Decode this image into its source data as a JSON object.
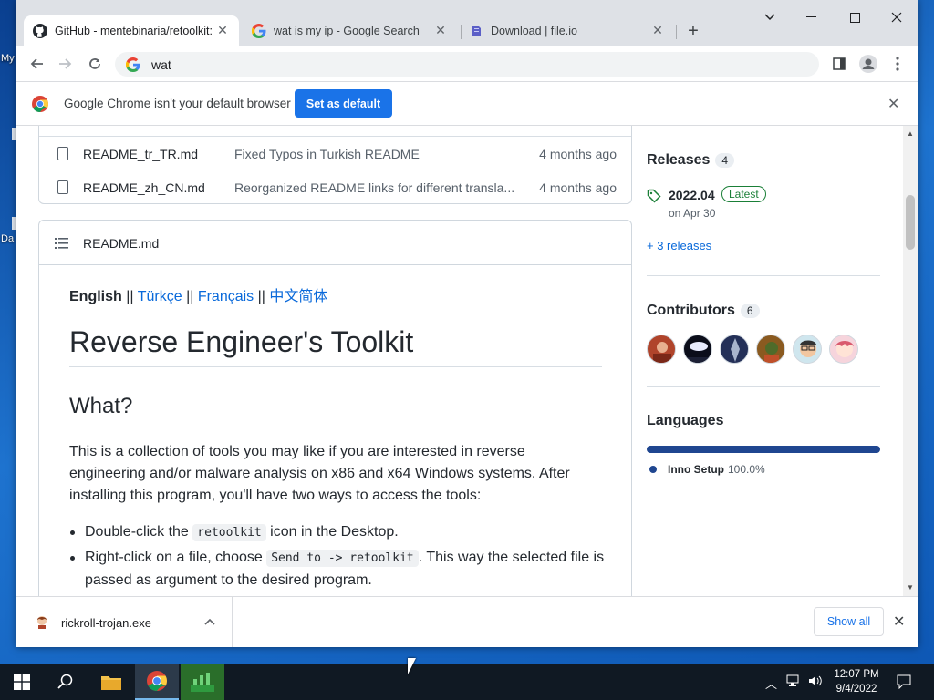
{
  "desktop": {
    "icon1_label": "My",
    "icon2_label": "Da"
  },
  "tabs": [
    {
      "title": "GitHub - mentebinaria/retoolkit: R",
      "icon": "github-icon"
    },
    {
      "title": "wat is my ip - Google Search",
      "icon": "google-icon"
    },
    {
      "title": "Download | file.io",
      "icon": "fileio-icon"
    }
  ],
  "omnibox": {
    "value": "wat"
  },
  "infobar": {
    "text": "Google Chrome isn't your default browser",
    "button": "Set as default"
  },
  "files": [
    {
      "name": "README_tr_TR.md",
      "message": "Fixed Typos in Turkish README",
      "age": "4 months ago"
    },
    {
      "name": "README_zh_CN.md",
      "message": "Reorganized README links for different transla...",
      "age": "4 months ago"
    }
  ],
  "readme": {
    "title": "README.md",
    "lang_english": "English",
    "sep": "||",
    "lang_turkce": "Türkçe",
    "lang_francais": "Français",
    "lang_chinese": "中文简体",
    "h1": "Reverse Engineer's Toolkit",
    "h2": "What?",
    "para": "This is a collection of tools you may like if you are interested in reverse engineering and/or malware analysis on x86 and x64 Windows systems. After installing this program, you'll have two ways to access the tools:",
    "bullet1_pre": "Double-click the ",
    "bullet1_code": "retoolkit",
    "bullet1_post": " icon in the Desktop.",
    "bullet2_pre": "Right-click on a file, choose ",
    "bullet2_code": "Send to -> retoolkit",
    "bullet2_post": ". This way the selected file is passed as argument to the desired program."
  },
  "sidebar": {
    "releases": {
      "heading": "Releases",
      "count": "4",
      "version": "2022.04",
      "badge": "Latest",
      "date": "on Apr 30",
      "more": "+ 3 releases"
    },
    "contributors": {
      "heading": "Contributors",
      "count": "6"
    },
    "languages": {
      "heading": "Languages",
      "name": "Inno Setup",
      "percent": "100.0%",
      "fraction": 1.0,
      "color": "#1f4690"
    }
  },
  "download": {
    "filename": "rickroll-trojan.exe",
    "show_all": "Show all"
  },
  "clock": {
    "time": "12:07 PM",
    "date": "9/4/2022"
  },
  "colors": {
    "accent": "#1a73e8",
    "link": "#0969da",
    "latest": "#1a7f37"
  }
}
